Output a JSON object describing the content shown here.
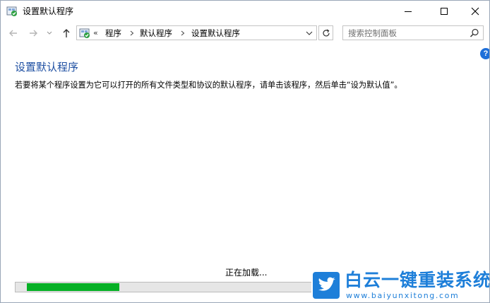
{
  "window": {
    "title": "设置默认程序"
  },
  "address": {
    "overflow": "«",
    "crumbs": [
      "程序",
      "默认程序",
      "设置默认程序"
    ]
  },
  "search": {
    "placeholder": "搜索控制面板"
  },
  "help": {
    "glyph": "?"
  },
  "content": {
    "title": "设置默认程序",
    "description": "若要将某个程序设置为它可以打开的所有文件类型和协议的默认程序，请单击该程序，然后单击“设为默认值”。"
  },
  "loading": {
    "text": "正在加载...",
    "progress_fraction": 0.2
  },
  "watermark": {
    "name": "白云一键重装系统",
    "url": "www.baiyunxitong.com"
  },
  "colors": {
    "accent": "#1e4fa2",
    "progress": "#06b025",
    "watermark": "#1e7fd9"
  }
}
